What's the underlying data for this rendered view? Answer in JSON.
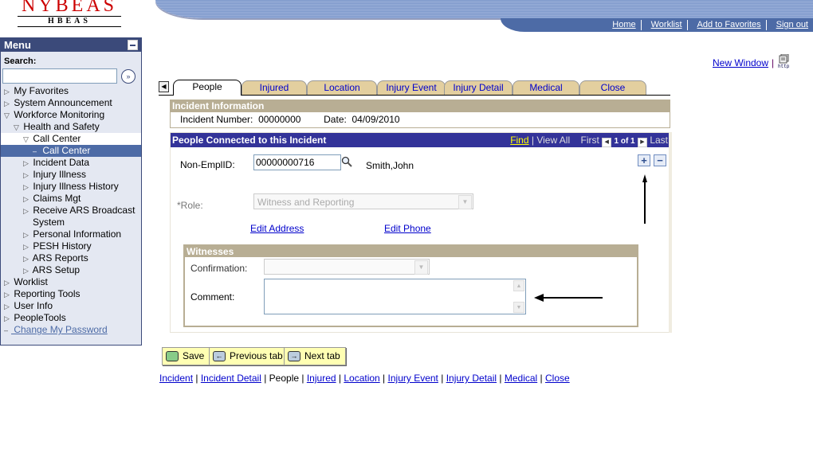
{
  "header": {
    "logo_main": "NYBEAS",
    "logo_sub": "HBEAS",
    "nav": [
      "Home",
      "Worklist",
      "Add to Favorites",
      "Sign out"
    ],
    "new_window": "New Window",
    "http_icon": "http"
  },
  "sidebar": {
    "title": "Menu",
    "search_label": "Search:",
    "search_value": "",
    "go_icon": "»",
    "items": [
      {
        "label": "My Favorites",
        "icon": "▷",
        "indent": 0
      },
      {
        "label": "System Announcement",
        "icon": "▷",
        "indent": 0
      },
      {
        "label": "Workforce Monitoring",
        "icon": "▽",
        "indent": 0
      },
      {
        "label": "Health and Safety",
        "icon": "▽",
        "indent": 1
      },
      {
        "label": "Call Center",
        "icon": "▽",
        "indent": 2
      },
      {
        "label": "Call Center",
        "icon": "–",
        "indent": 3
      },
      {
        "label": "Incident Data",
        "icon": "▷",
        "indent": 2
      },
      {
        "label": "Injury Illness",
        "icon": "▷",
        "indent": 2
      },
      {
        "label": "Injury Illness History",
        "icon": "▷",
        "indent": 2
      },
      {
        "label": "Claims Mgt",
        "icon": "▷",
        "indent": 2
      },
      {
        "label": "Receive ARS Broadcast",
        "icon": "▷",
        "indent": 2
      },
      {
        "label": "System",
        "icon": "",
        "indent": 2
      },
      {
        "label": "Personal Information",
        "icon": "▷",
        "indent": 2
      },
      {
        "label": "PESH History",
        "icon": "▷",
        "indent": 2
      },
      {
        "label": "ARS Reports",
        "icon": "▷",
        "indent": 2
      },
      {
        "label": "ARS Setup",
        "icon": "▷",
        "indent": 2
      },
      {
        "label": "Worklist",
        "icon": "▷",
        "indent": 0
      },
      {
        "label": "Reporting Tools",
        "icon": "▷",
        "indent": 0
      },
      {
        "label": "User Info",
        "icon": "▷",
        "indent": 0
      },
      {
        "label": "PeopleTools",
        "icon": "▷",
        "indent": 0
      },
      {
        "label": "Change My Password",
        "icon": "–",
        "indent": 0
      }
    ]
  },
  "tabs": [
    "People",
    "Injured",
    "Location",
    "Injury Event",
    "Injury Detail",
    "Medical",
    "Close"
  ],
  "active_tab": "People",
  "incident": {
    "title": "Incident Information",
    "number_label": "Incident Number:",
    "number_value": "00000000",
    "date_label": "Date:",
    "date_value": "04/09/2010"
  },
  "people": {
    "title": "People Connected to this Incident",
    "find": "Find",
    "view_all": "View All",
    "first": "First",
    "count": "1 of 1",
    "last": "Last",
    "emplid_label": "Non-EmplID:",
    "emplid_value": "00000000716",
    "name": "Smith,John",
    "role_label": "*Role:",
    "role_value": "Witness and Reporting",
    "edit_address": "Edit Address",
    "edit_phone": "Edit Phone",
    "add": "+",
    "remove": "−"
  },
  "witnesses": {
    "title": "Witnesses",
    "confirmation_label": "Confirmation:",
    "confirmation_value": "",
    "comment_label": "Comment:",
    "comment_value": ""
  },
  "buttons": {
    "save": "Save",
    "previous": "Previous tab",
    "next": "Next tab"
  },
  "footer_links": [
    "Incident",
    "Incident Detail",
    "People",
    "Injured",
    "Location",
    "Injury Event",
    "Injury Detail",
    "Medical",
    "Close"
  ],
  "footer_current": "People"
}
